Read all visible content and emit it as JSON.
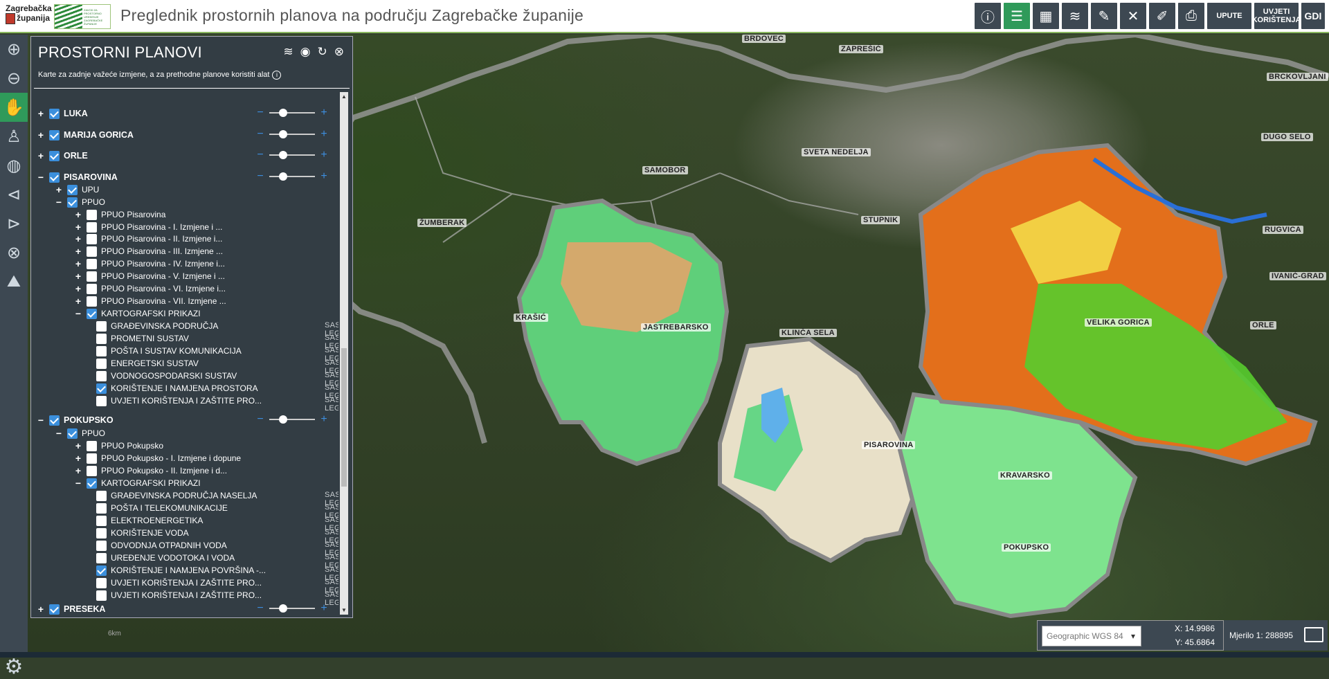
{
  "header": {
    "logo_text_1": "Zagrebačka",
    "logo_text_2": "županija",
    "logo2_text": "ZAVOD ZA PROSTORNO UREĐENJE ZAGREBAČKE ŽUPANIJE",
    "title": "Preglednik prostornih planova na području Zagrebačke županije"
  },
  "toolbar": {
    "info_icon": "info-icon",
    "layers_icon": "list-icon",
    "upute": "UPUTE",
    "uvjeti": "UVJETI KORIŠTENJA",
    "gdi": "GDI"
  },
  "panel": {
    "title": "PROSTORNI PLANOVI",
    "note": "Karte za zadnje važeće izmjene, a za prethodne planove koristiti alat",
    "sas": "SAS. LEG."
  },
  "tree": [
    {
      "label": "LUKA",
      "level": 0,
      "exp": "+",
      "checked": true,
      "bold": true,
      "opacity": true
    },
    {
      "label": "MARIJA GORICA",
      "level": 0,
      "exp": "+",
      "checked": true,
      "bold": true,
      "opacity": true
    },
    {
      "label": "ORLE",
      "level": 0,
      "exp": "+",
      "checked": true,
      "bold": true,
      "opacity": true
    },
    {
      "label": "PISAROVINA",
      "level": 0,
      "exp": "−",
      "checked": true,
      "bold": true,
      "opacity": true
    },
    {
      "label": "UPU",
      "level": 1,
      "exp": "+",
      "checked": true
    },
    {
      "label": "PPUO",
      "level": 1,
      "exp": "−",
      "checked": true
    },
    {
      "label": "PPUO Pisarovina",
      "level": 2,
      "exp": "+",
      "checked": false
    },
    {
      "label": "PPUO Pisarovina - I. Izmjene i ...",
      "level": 2,
      "exp": "+",
      "checked": false
    },
    {
      "label": "PPUO Pisarovina - II. Izmjene i...",
      "level": 2,
      "exp": "+",
      "checked": false
    },
    {
      "label": "PPUO Pisarovina - III. Izmjene ...",
      "level": 2,
      "exp": "+",
      "checked": false
    },
    {
      "label": "PPUO Pisarovina - IV. Izmjene i...",
      "level": 2,
      "exp": "+",
      "checked": false
    },
    {
      "label": "PPUO Pisarovina - V. Izmjene i ...",
      "level": 2,
      "exp": "+",
      "checked": false
    },
    {
      "label": "PPUO Pisarovina - VI. Izmjene i...",
      "level": 2,
      "exp": "+",
      "checked": false
    },
    {
      "label": "PPUO Pisarovina - VII. Izmjene ...",
      "level": 2,
      "exp": "+",
      "checked": false
    },
    {
      "label": "KARTOGRAFSKI PRIKAZI",
      "level": 2,
      "exp": "−",
      "checked": true
    },
    {
      "label": "GRAĐEVINSKA PODRUČJA",
      "level": 3,
      "checked": false,
      "sas": true
    },
    {
      "label": "PROMETNI SUSTAV",
      "level": 3,
      "checked": false,
      "sas": true
    },
    {
      "label": "POŠTA I SUSTAV KOMUNIKACIJA",
      "level": 3,
      "checked": false,
      "sas": true
    },
    {
      "label": "ENERGETSKI SUSTAV",
      "level": 3,
      "checked": false,
      "sas": true
    },
    {
      "label": "VODNOGOSPODARSKI SUSTAV",
      "level": 3,
      "checked": false,
      "sas": true
    },
    {
      "label": "KORIŠTENJE I NAMJENA PROSTORA",
      "level": 3,
      "checked": true,
      "sas": true
    },
    {
      "label": "UVJETI KORIŠTENJA I ZAŠTITE PRO...",
      "level": 3,
      "checked": false,
      "sas": true
    },
    {
      "label": "POKUPSKO",
      "level": 0,
      "exp": "−",
      "checked": true,
      "bold": true,
      "opacity": true
    },
    {
      "label": "PPUO",
      "level": 1,
      "exp": "−",
      "checked": true
    },
    {
      "label": "PPUO Pokupsko",
      "level": 2,
      "exp": "+",
      "checked": false
    },
    {
      "label": "PPUO Pokupsko - I. Izmjene i dopune",
      "level": 2,
      "exp": "+",
      "checked": false
    },
    {
      "label": "PPUO Pokupsko - II. Izmjene i d...",
      "level": 2,
      "exp": "+",
      "checked": false
    },
    {
      "label": "KARTOGRAFSKI PRIKAZI",
      "level": 2,
      "exp": "−",
      "checked": true
    },
    {
      "label": "GRAĐEVINSKA PODRUČJA NASELJA",
      "level": 3,
      "checked": false,
      "sas": true
    },
    {
      "label": "POŠTA I TELEKOMUNIKACIJE",
      "level": 3,
      "checked": false,
      "sas": true
    },
    {
      "label": "ELEKTROENERGETIKA",
      "level": 3,
      "checked": false,
      "sas": true
    },
    {
      "label": "KORIŠTENJE VODA",
      "level": 3,
      "checked": false,
      "sas": true
    },
    {
      "label": "ODVODNJA OTPADNIH VODA",
      "level": 3,
      "checked": false,
      "sas": true
    },
    {
      "label": "UREĐENJE VODOTOKA I VODA",
      "level": 3,
      "checked": false,
      "sas": true
    },
    {
      "label": "KORIŠTENJE I NAMJENA POVRŠINA -...",
      "level": 3,
      "checked": true,
      "sas": true
    },
    {
      "label": "UVJETI KORIŠTENJA I ZAŠTITE PRO...",
      "level": 3,
      "checked": false,
      "sas": true
    },
    {
      "label": "UVJETI KORIŠTENJA I ZAŠTITE PRO...",
      "level": 3,
      "checked": false,
      "sas": true
    },
    {
      "label": "PRESEKA",
      "level": 0,
      "exp": "+",
      "checked": true,
      "bold": true,
      "opacity": true
    }
  ],
  "map": {
    "labels": [
      "BRDOVEC",
      "ZAPREŠIĆ",
      "BRCKOVLJANI",
      "DUGO SELO",
      "SAMOBOR",
      "SVETA NEDELJA",
      "ŽUMBERAK",
      "STUPNIK",
      "RUGVICA",
      "IVANIĆ-GRAD",
      "KRAŠIĆ",
      "JASTREBARSKO",
      "KLINČA SELA",
      "VELIKA GORICA",
      "ORLE",
      "PISAROVINA",
      "KRAVARSKO",
      "POKUPSKO"
    ]
  },
  "footer": {
    "crs": "Geographic WGS 84",
    "x": "X: 14.9986",
    "y": "Y: 45.6864",
    "scale": "Mjerilo 1: 288895",
    "scale_bar": "6km"
  }
}
